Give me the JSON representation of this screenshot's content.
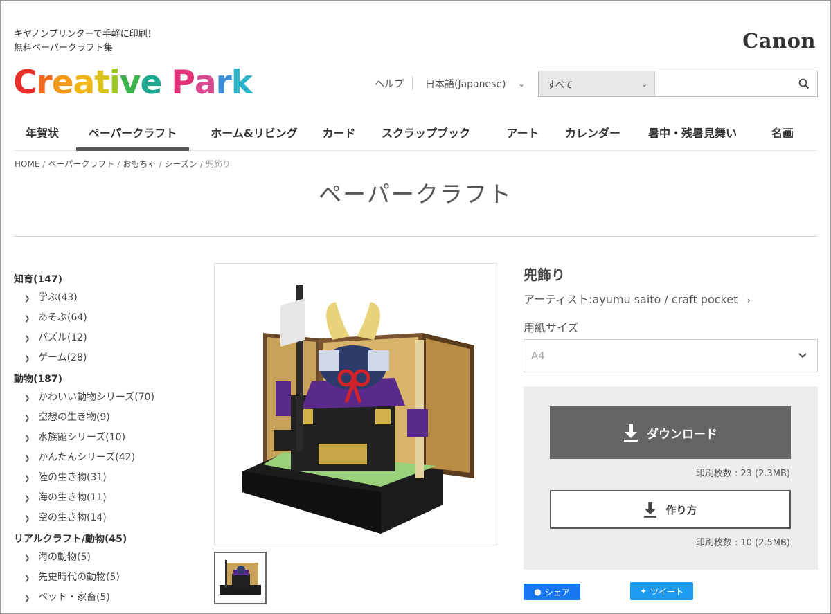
{
  "header": {
    "tagline_line1": "キヤノンプリンターで手軽に印刷！",
    "tagline_line2": "無料ペーパークラフト集",
    "brand": "Canon",
    "site_logo_letters": [
      {
        "ch": "C",
        "color": "#e8302a"
      },
      {
        "ch": "r",
        "color": "#f06a1f"
      },
      {
        "ch": "e",
        "color": "#f39a1d"
      },
      {
        "ch": "a",
        "color": "#f2b51a"
      },
      {
        "ch": "t",
        "color": "#d9c21c"
      },
      {
        "ch": "i",
        "color": "#9cc624"
      },
      {
        "ch": "v",
        "color": "#3db14a"
      },
      {
        "ch": "e",
        "color": "#1fa88f"
      },
      {
        "ch": " ",
        "color": "#ffffff"
      },
      {
        "ch": "P",
        "color": "#e2327a"
      },
      {
        "ch": "a",
        "color": "#d84b91"
      },
      {
        "ch": "r",
        "color": "#3a8fd8"
      },
      {
        "ch": "k",
        "color": "#2bb3c8"
      }
    ],
    "help": "ヘルプ",
    "language": "日本語(Japanese)",
    "search": {
      "category": "すべて",
      "value": "",
      "placeholder": ""
    }
  },
  "nav": {
    "items": [
      {
        "label": "年賀状",
        "active": false
      },
      {
        "label": "ペーパークラフト",
        "active": true
      },
      {
        "label": "ホーム&リビング",
        "active": false
      },
      {
        "label": "カード",
        "active": false
      },
      {
        "label": "スクラップブック",
        "active": false
      },
      {
        "label": "アート",
        "active": false
      },
      {
        "label": "カレンダー",
        "active": false
      },
      {
        "label": "暑中・残暑見舞い",
        "active": false
      },
      {
        "label": "名画",
        "active": false
      }
    ]
  },
  "breadcrumb": {
    "items": [
      "HOME",
      "ペーパークラフト",
      "おもちゃ",
      "シーズン"
    ],
    "current": "兜飾り"
  },
  "page_title": "ペーパークラフト",
  "sidebar": {
    "groups": [
      {
        "title": "知育(147)",
        "items": [
          "学ぶ(43)",
          "あそぶ(64)",
          "パズル(12)",
          "ゲーム(28)"
        ]
      },
      {
        "title": "動物(187)",
        "items": [
          "かわいい動物シリーズ(70)",
          "空想の生き物(9)",
          "水族館シリーズ(10)",
          "かんたんシリーズ(42)",
          "陸の生き物(31)",
          "海の生き物(11)",
          "空の生き物(14)"
        ]
      },
      {
        "title": "リアルクラフト/動物(45)",
        "items": [
          "海の動物(5)",
          "先史時代の動物(5)",
          "ペット・家畜(5)"
        ]
      }
    ]
  },
  "product": {
    "name": "兜飾り",
    "artist": "アーティスト:ayumu saito / craft pocket",
    "paper_size_label": "用紙サイズ",
    "paper_size_value": "A4",
    "download_label": "ダウンロード",
    "download_count": "印刷枚数 : 23 (2.3MB)",
    "howto_label": "作り方",
    "howto_count": "印刷枚数 : 10 (2.5MB)"
  },
  "share": {
    "facebook": "シェア",
    "twitter": "ツイート"
  },
  "colors": {
    "accent_dark": "#656565",
    "facebook": "#1877f2",
    "twitter": "#1d9bf0"
  }
}
